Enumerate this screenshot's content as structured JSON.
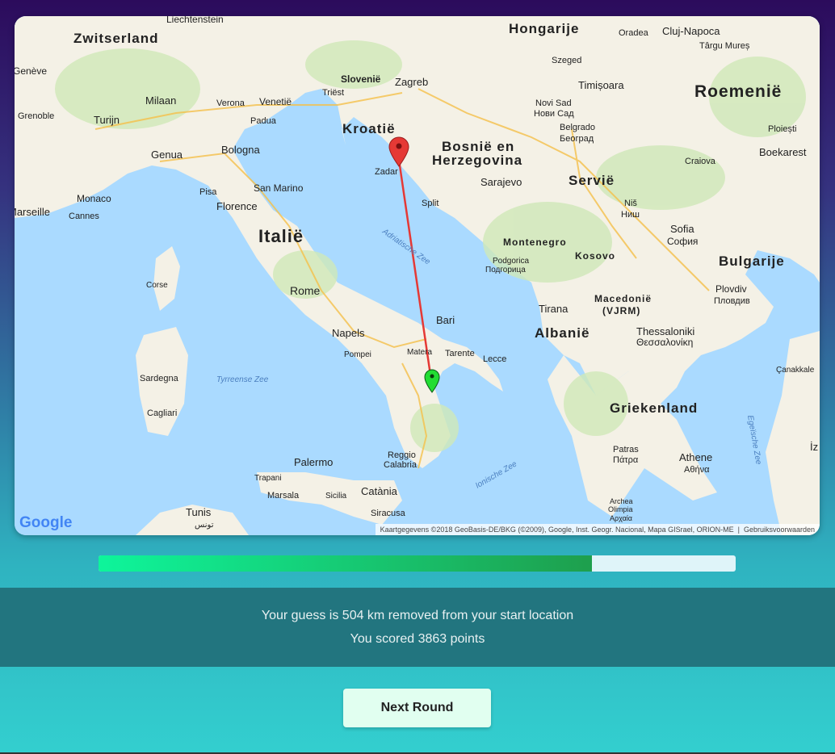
{
  "map": {
    "countries": [
      "Zwitserland",
      "Hongarije",
      "Roemenië",
      "Kroatië",
      "Bosnië en",
      "Herzegovina",
      "Servië",
      "Italië",
      "Montenegro",
      "Kosovo",
      "Bulgarije",
      "Macedonië",
      "(VJRM)",
      "Albanië",
      "Griekenland"
    ],
    "cities": [
      "Liechtenstein",
      "Genève",
      "Grenoble",
      "Turijn",
      "Milaan",
      "Verona",
      "Venetië",
      "Padua",
      "Triëst",
      "Slovenië",
      "Zagreb",
      "Oradea",
      "Cluj-Napoca",
      "Târgu Mureș",
      "Szeged",
      "Timișoara",
      "Novi Sad",
      "Нови Сад",
      "Belgrado",
      "Београд",
      "Ploiești",
      "Boekarest",
      "Craiova",
      "Genua",
      "Bologna",
      "Zadar",
      "Split",
      "Sarajevo",
      "Pisa",
      "San Marino",
      "Florence",
      "Monaco",
      "Cannes",
      "Marseille",
      "Niš",
      "Ниш",
      "Sofia",
      "София",
      "Podgorica",
      "Подгорица",
      "Plovdiv",
      "Пловдив",
      "Corse",
      "Rome",
      "Bari",
      "Tirana",
      "Napels",
      "Pompei",
      "Matera",
      "Tarente",
      "Lecce",
      "Thessaloniki",
      "Θεσσαλονίκη",
      "Sardegna",
      "Cagliari",
      "Palermo",
      "Reggio",
      "Calabria",
      "Catània",
      "Trapani",
      "Marsala",
      "Sicilia",
      "Siracusa",
      "Tunis",
      "تونس",
      "Patras",
      "Πάτρα",
      "Athene",
      "Αθήνα",
      "Archea",
      "Olimpia",
      "Αρχαία",
      "Çanakkale",
      "İz"
    ],
    "seas": [
      "Adriatische Zee",
      "Tyrreense Zee",
      "Ionische Zee",
      "Egeïsche Zee"
    ],
    "google_logo": "Google",
    "attribution": "Kaartgegevens ©2018 GeoBasis-DE/BKG (©2009), Google, Inst. Geogr. Nacional, Mapa GISrael, ORION-ME",
    "terms": "Gebruiksvoorwaarden",
    "guess_marker_color": "#e53935",
    "actual_marker_color": "#22dd33",
    "line_color": "#e53935",
    "water_color": "#aadaff",
    "land_color": "#f4f1e6"
  },
  "progress": {
    "fraction": 0.775
  },
  "result": {
    "distance_text": "Your guess is 504 km removed from your start location",
    "score_text": "You scored 3863 points"
  },
  "actions": {
    "next_round_label": "Next Round"
  }
}
